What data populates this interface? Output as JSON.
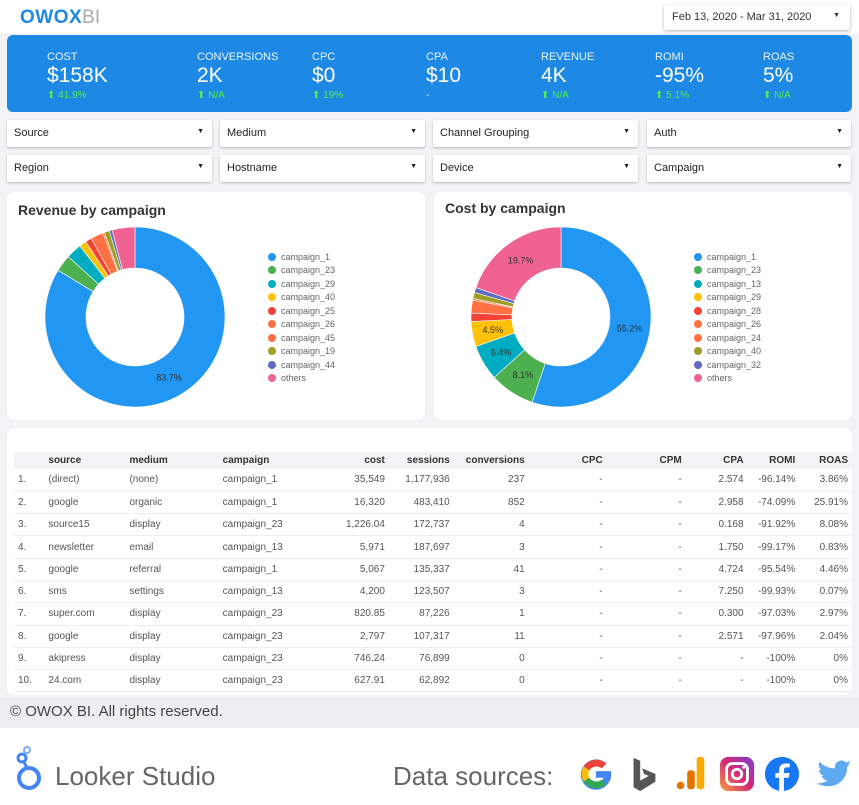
{
  "header": {
    "logo_main": "OWOX",
    "logo_suffix": "BI",
    "date_range": "Feb 13, 2020 - Mar 31, 2020"
  },
  "kpis": [
    {
      "label": "COST",
      "value": "$158K",
      "delta": "41.9%",
      "trend": "up"
    },
    {
      "label": "CONVERSIONS",
      "value": "2K",
      "delta": "N/A",
      "trend": "up"
    },
    {
      "label": "CPC",
      "value": "$0",
      "delta": "19%",
      "trend": "up"
    },
    {
      "label": "CPA",
      "value": "$10",
      "delta": "-",
      "trend": "none"
    },
    {
      "label": "REVENUE",
      "value": "4K",
      "delta": "N/A",
      "trend": "up"
    },
    {
      "label": "ROMI",
      "value": "-95%",
      "delta": "5.1%",
      "trend": "up"
    },
    {
      "label": "ROAS",
      "value": "5%",
      "delta": "N/A",
      "trend": "up"
    }
  ],
  "filters": [
    "Source",
    "Medium",
    "Channel Grouping",
    "Auth",
    "Region",
    "Hostname",
    "Device",
    "Campaign"
  ],
  "colors": {
    "accent": "#1e88e5",
    "positive": "#4cef4c"
  },
  "chart_data": [
    {
      "type": "pie",
      "title": "Revenue by campaign",
      "donut": true,
      "labels": [
        "campaign_1",
        "campaign_23",
        "campaign_29",
        "campaign_40",
        "campaign_25",
        "campaign_26",
        "campaign_45",
        "campaign_19",
        "campaign_44",
        "others"
      ],
      "values": [
        83.7,
        3.0,
        2.8,
        1.3,
        1.1,
        2.3,
        0.3,
        0.9,
        0.5,
        4.1
      ],
      "colors": [
        "#2196f3",
        "#4caf50",
        "#00acc1",
        "#ffc107",
        "#f44336",
        "#ff7043",
        "#ff7043",
        "#9e9d24",
        "#5c6bc0",
        "#f06292"
      ],
      "data_labels": [
        "83.7%",
        "",
        "",
        "",
        "",
        "",
        "",
        "",
        "",
        ""
      ],
      "legend": "right"
    },
    {
      "type": "pie",
      "title": "Cost by campaign",
      "donut": true,
      "labels": [
        "campaign_1",
        "campaign_23",
        "campaign_13",
        "campaign_29",
        "campaign_28",
        "campaign_26",
        "campaign_24",
        "campaign_40",
        "campaign_32",
        "others"
      ],
      "values": [
        55.2,
        8.1,
        6.4,
        4.5,
        1.5,
        2.3,
        0.3,
        1.1,
        0.9,
        19.7
      ],
      "colors": [
        "#2196f3",
        "#4caf50",
        "#00acc1",
        "#ffc107",
        "#f44336",
        "#ff7043",
        "#ff7043",
        "#9e9d24",
        "#5c6bc0",
        "#f06292"
      ],
      "data_labels": [
        "55.2%",
        "8.1%",
        "6.4%",
        "4.5%",
        "",
        "",
        "",
        "",
        "",
        "19.7%"
      ],
      "legend": "right"
    }
  ],
  "table": {
    "columns": [
      "",
      "source",
      "medium",
      "campaign",
      "cost",
      "sessions",
      "conversions",
      "CPC",
      "CPM",
      "CPA",
      "ROMI",
      "ROAS"
    ],
    "rows": [
      [
        "1.",
        "(direct)",
        "(none)",
        "campaign_1",
        "35,549",
        "1,177,936",
        "237",
        "-",
        "-",
        "2.574",
        "-96.14%",
        "3.86%"
      ],
      [
        "2.",
        "google",
        "organic",
        "campaign_1",
        "16,320",
        "483,410",
        "852",
        "-",
        "-",
        "2.958",
        "-74.09%",
        "25.91%"
      ],
      [
        "3.",
        "source15",
        "display",
        "campaign_23",
        "1,226.04",
        "172,737",
        "4",
        "-",
        "-",
        "0.168",
        "-91.92%",
        "8.08%"
      ],
      [
        "4.",
        "newsletter",
        "email",
        "campaign_13",
        "5,971",
        "187,697",
        "3",
        "-",
        "-",
        "1.750",
        "-99.17%",
        "0.83%"
      ],
      [
        "5.",
        "google",
        "referral",
        "campaign_1",
        "5,067",
        "135,337",
        "41",
        "-",
        "-",
        "4.724",
        "-95.54%",
        "4.46%"
      ],
      [
        "6.",
        "sms",
        "settings",
        "campaign_13",
        "4,200",
        "123,507",
        "3",
        "-",
        "-",
        "7.250",
        "-99.93%",
        "0.07%"
      ],
      [
        "7.",
        "super.com",
        "display",
        "campaign_23",
        "820.85",
        "87,226",
        "1",
        "-",
        "-",
        "0.300",
        "-97.03%",
        "2.97%"
      ],
      [
        "8.",
        "google",
        "display",
        "campaign_23",
        "2,797",
        "107,317",
        "11",
        "-",
        "-",
        "2.571",
        "-97.96%",
        "2.04%"
      ],
      [
        "9.",
        "akipress",
        "display",
        "campaign_23",
        "746.24",
        "76,899",
        "0",
        "-",
        "-",
        "-",
        "-100%",
        "0%"
      ],
      [
        "10.",
        "24.com",
        "display",
        "campaign_23",
        "627.91",
        "62,892",
        "0",
        "-",
        "-",
        "-",
        "-100%",
        "0%"
      ]
    ]
  },
  "footer": {
    "copyright": "© OWOX BI. All rights reserved.",
    "looker": "Looker Studio",
    "data_sources": "Data sources:",
    "source_icons": [
      "google-icon",
      "bing-icon",
      "google-analytics-icon",
      "instagram-icon",
      "facebook-icon",
      "twitter-icon"
    ]
  }
}
